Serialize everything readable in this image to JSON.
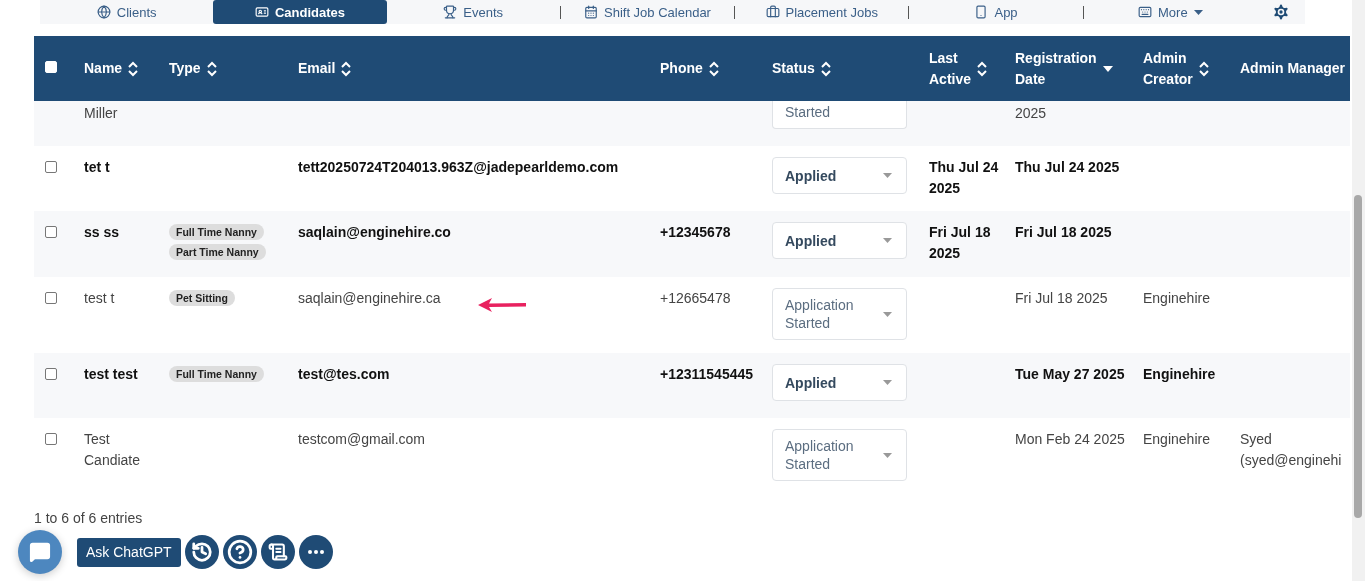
{
  "nav": {
    "items": [
      {
        "label": "Clients",
        "selected": false
      },
      {
        "label": "Candidates",
        "selected": true
      },
      {
        "label": "Events",
        "selected": false
      },
      {
        "label": "Shift Job Calendar",
        "selected": false
      },
      {
        "label": "Placement Jobs",
        "selected": false
      },
      {
        "label": "App",
        "selected": false
      },
      {
        "label": "More",
        "selected": false
      }
    ]
  },
  "table": {
    "select_all": {
      "checked": false
    },
    "columns": [
      {
        "label": "Name",
        "sortable": true,
        "sorted_desc": false
      },
      {
        "label": "Type",
        "sortable": true,
        "sorted_desc": false
      },
      {
        "label": "Email",
        "sortable": true,
        "sorted_desc": false
      },
      {
        "label": "Phone",
        "sortable": true,
        "sorted_desc": false
      },
      {
        "label": "Status",
        "sortable": true,
        "sorted_desc": false
      },
      {
        "label": "Last Active",
        "sortable": true,
        "sorted_desc": false
      },
      {
        "label": "Registration Date",
        "sortable": false,
        "sorted_desc": true
      },
      {
        "label": "Admin Creator",
        "sortable": true,
        "sorted_desc": false
      },
      {
        "label": "Admin Manager",
        "sortable": false,
        "sorted_desc": false
      }
    ],
    "partial_row": {
      "name": "Miller",
      "status": "Started",
      "registration_date": "2025"
    },
    "rows": [
      {
        "checked": false,
        "unread": true,
        "pointed": false,
        "name": "tet t",
        "types": [],
        "email": "tett20250724T204013.963Z@jadepearldemo.com",
        "phone": "",
        "status": "Applied",
        "last_active": "Thu Jul 24 2025",
        "registration_date": "Thu Jul 24 2025",
        "admin_creator": "",
        "admin_manager": ""
      },
      {
        "checked": false,
        "unread": true,
        "pointed": false,
        "name": "ss ss",
        "types": [
          "Full Time Nanny",
          "Part Time Nanny"
        ],
        "email": "saqlain@enginehire.co",
        "phone": "+12345678",
        "status": "Applied",
        "last_active": "Fri Jul 18 2025",
        "registration_date": "Fri Jul 18 2025",
        "admin_creator": "",
        "admin_manager": ""
      },
      {
        "checked": false,
        "unread": false,
        "pointed": true,
        "name": "test t",
        "types": [
          "Pet Sitting"
        ],
        "email": "saqlain@enginehire.ca",
        "phone": "+12665478",
        "status": "Application Started",
        "last_active": "",
        "registration_date": "Fri Jul 18 2025",
        "admin_creator": "Enginehire",
        "admin_manager": ""
      },
      {
        "checked": false,
        "unread": true,
        "pointed": false,
        "name": "test test",
        "types": [
          "Full Time Nanny"
        ],
        "email": "test@tes.com",
        "phone": "+12311545445",
        "status": "Applied",
        "last_active": "",
        "registration_date": "Tue May 27 2025",
        "admin_creator": "Enginehire",
        "admin_manager": ""
      },
      {
        "checked": false,
        "unread": false,
        "pointed": false,
        "name": "Test Candiate",
        "types": [],
        "email": "testcom@gmail.com",
        "phone": "",
        "status": "Application Started",
        "last_active": "",
        "registration_date": "Mon Feb 24 2025",
        "admin_creator": "Enginehire",
        "admin_manager": "Syed (syed@enginehi"
      }
    ]
  },
  "footer": {
    "entries": "1 to 6 of 6 entries"
  },
  "floating": {
    "ask_label": "Ask ChatGPT"
  }
}
